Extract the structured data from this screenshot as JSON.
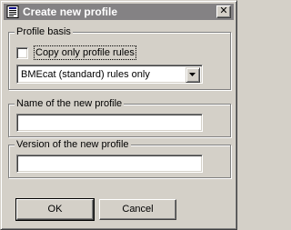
{
  "window": {
    "title": "Create new profile",
    "close_symbol": "✕",
    "title_icon": "form-icon"
  },
  "profile_basis": {
    "legend": "Profile basis",
    "copy_checkbox": {
      "label": "Copy only profile rules",
      "checked": false
    },
    "ruleset_select": {
      "value": "BMEcat (standard) rules only"
    }
  },
  "name_group": {
    "legend": "Name of the new profile",
    "value": ""
  },
  "version_group": {
    "legend": "Version of the new profile",
    "value": ""
  },
  "buttons": {
    "ok_label": "OK",
    "cancel_label": "Cancel"
  },
  "colors": {
    "titlebar": "#848284",
    "face": "#d4d0c8"
  }
}
